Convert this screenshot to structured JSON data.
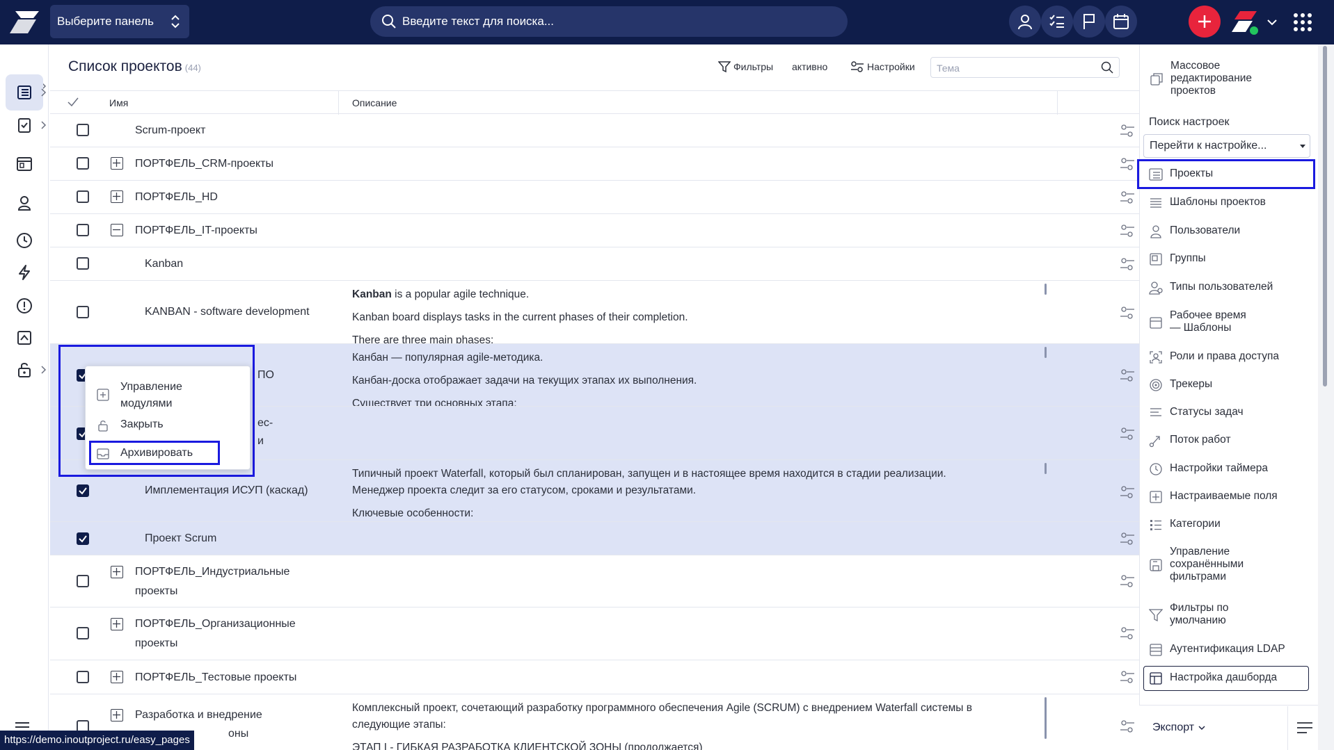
{
  "topbar": {
    "panel_select": "Выберите панель",
    "search_placeholder": "Введите текст для поиска..."
  },
  "main": {
    "title": "Список проектов",
    "count": "(44)",
    "filters_label": "Фильтры",
    "active_label": "активно",
    "settings_label": "Настройки",
    "theme_placeholder": "Тема",
    "col_name": "Имя",
    "col_desc": "Описание"
  },
  "rows": [
    {
      "name": "Scrum-проект"
    },
    {
      "name": "ПОРТФЕЛЬ_CRM-проекты"
    },
    {
      "name": "ПОРТФЕЛЬ_HD"
    },
    {
      "name": "ПОРТФЕЛЬ_IT-проекты"
    },
    {
      "name": "Kanban"
    },
    {
      "name": "KANBAN - software development",
      "desc_bold": "Kanban",
      "desc1": " is a popular agile technique.",
      "desc2": "Kanban board displays tasks in the current phases of their completion.",
      "desc3": "There are three main phases:"
    },
    {
      "name_tail": "ПО",
      "desc1": "Канбан — популярная agile-методика.",
      "desc2": "Канбан-доска отображает задачи на текущих этапах их выполнения.",
      "desc3": "Существует три основных этапа:"
    },
    {
      "name_tail1": "ес-",
      "name_tail2": "и"
    },
    {
      "name": "Имплементация ИСУП (каскад)",
      "desc1": "Типичный проект Waterfall, который был спланирован, запущен и в настоящее время находится в стадии реализации.",
      "desc2": "Менеджер проекта следит за его статусом, сроками и результатами.",
      "desc3": "Ключевые особенности:"
    },
    {
      "name": "Проект Scrum"
    },
    {
      "name1": "ПОРТФЕЛЬ_Индустриальные",
      "name2": "проекты"
    },
    {
      "name1": "ПОРТФЕЛЬ_Организационные",
      "name2": "проекты"
    },
    {
      "name": "ПОРТФЕЛЬ_Тестовые проекты"
    },
    {
      "name1": "Разработка и внедрение",
      "name2": "оны",
      "desc1": "Комплексный проект, сочетающий разработку программного обеспечения Agile (SCRUM) с внедрением Waterfall системы в",
      "desc2": "следующие этапы:",
      "desc3": "ЭТАП I - ГИБКАЯ РАЗРАБОТКА КЛИЕНТСКОЙ ЗОНЫ (продолжается)"
    }
  ],
  "context_menu": {
    "manage_modules": "Управление модулями",
    "manage_modules_l1": "Управление",
    "manage_modules_l2": "модулями",
    "close": "Закрыть",
    "archive": "Архивировать"
  },
  "right_panel": {
    "mass_edit_l1": "Массовое",
    "mass_edit_l2": "редактирование",
    "mass_edit_l3": "проектов",
    "search_label": "Поиск настроек",
    "select_value": "Перейти к настройке...",
    "items": [
      {
        "label": "Проекты",
        "icon": "projects-icon"
      },
      {
        "label": "Шаблоны проектов",
        "icon": "templates-icon"
      },
      {
        "label": "Пользователи",
        "icon": "user-icon"
      },
      {
        "label": "Группы",
        "icon": "groups-icon"
      },
      {
        "label": "Типы пользователей",
        "icon": "user-types-icon"
      },
      {
        "label_l1": "Рабочее время",
        "label_l2": "— Шаблоны",
        "icon": "calendar-icon"
      },
      {
        "label": "Роли и права доступа",
        "icon": "roles-icon"
      },
      {
        "label": "Трекеры",
        "icon": "trackers-icon"
      },
      {
        "label": "Статусы задач",
        "icon": "statuses-icon"
      },
      {
        "label": "Поток работ",
        "icon": "workflow-icon"
      },
      {
        "label": "Настройки таймера",
        "icon": "clock-icon"
      },
      {
        "label": "Настраиваемые поля",
        "icon": "custom-fields-icon"
      },
      {
        "label": "Категории",
        "icon": "categories-icon"
      },
      {
        "label_l1": "Управление",
        "label_l2": "сохранёнными",
        "label_l3": "фильтрами",
        "icon": "save-icon"
      },
      {
        "label_l1": "Фильтры по",
        "label_l2": "умолчанию",
        "icon": "filter-icon"
      },
      {
        "label": "Аутентификация LDAP",
        "icon": "ldap-icon"
      },
      {
        "label": "Настройка дашборда",
        "icon": "dashboard-icon"
      }
    ],
    "export_label": "Экспорт"
  },
  "status_url": "https://demo.inoutproject.ru/easy_pages",
  "colors": {
    "topbar": "#0f1d4a",
    "accent_red": "#e8243c",
    "selected_row": "#dde3f6",
    "highlight_outline": "#1a1adf"
  }
}
